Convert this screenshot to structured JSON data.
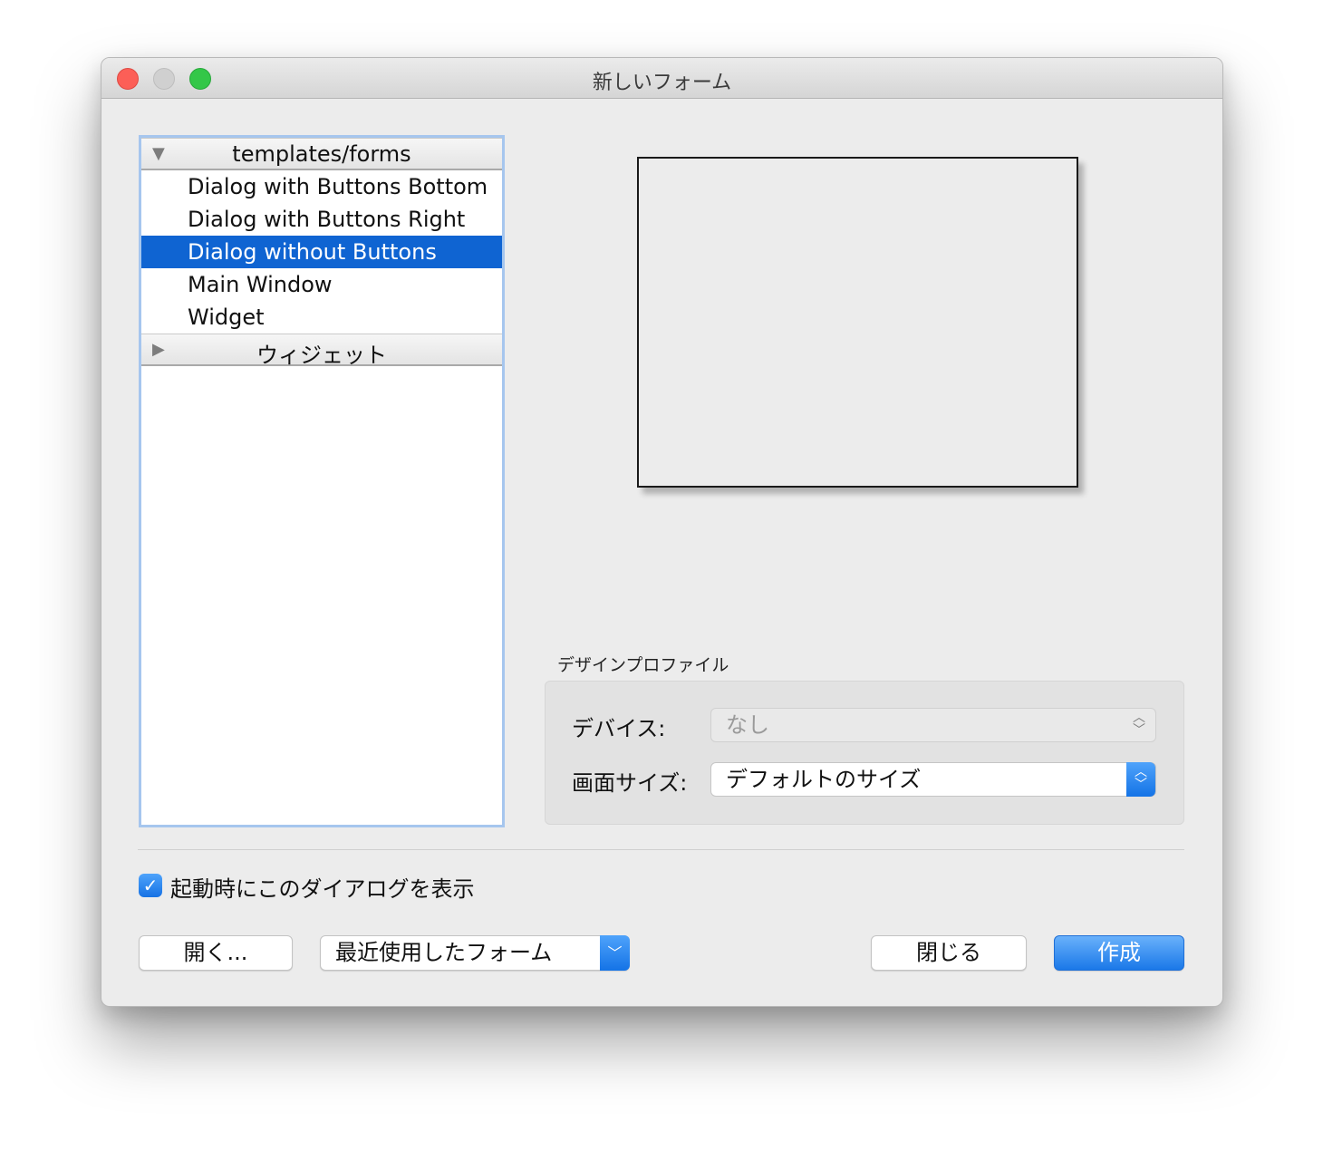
{
  "window": {
    "title": "新しいフォーム"
  },
  "tree": {
    "groups": [
      {
        "label": "templates/forms",
        "expanded": true,
        "items": [
          "Dialog with Buttons Bottom",
          "Dialog with Buttons Right",
          "Dialog without Buttons",
          "Main Window",
          "Widget"
        ]
      },
      {
        "label": "ウィジェット",
        "expanded": false
      }
    ],
    "selected_item": "Dialog without Buttons"
  },
  "design_profile": {
    "title": "デザインプロファイル",
    "device_label": "デバイス:",
    "device_value": "なし",
    "screen_size_label": "画面サイズ:",
    "screen_size_value": "デフォルトのサイズ"
  },
  "startup_checkbox": {
    "label": "起動時にこのダイアログを表示",
    "checked": true
  },
  "buttons": {
    "open": "開く...",
    "recent": "最近使用したフォーム",
    "close": "閉じる",
    "create": "作成"
  },
  "colors": {
    "selection": "#0f64d2",
    "accent": "#1a78e8"
  }
}
